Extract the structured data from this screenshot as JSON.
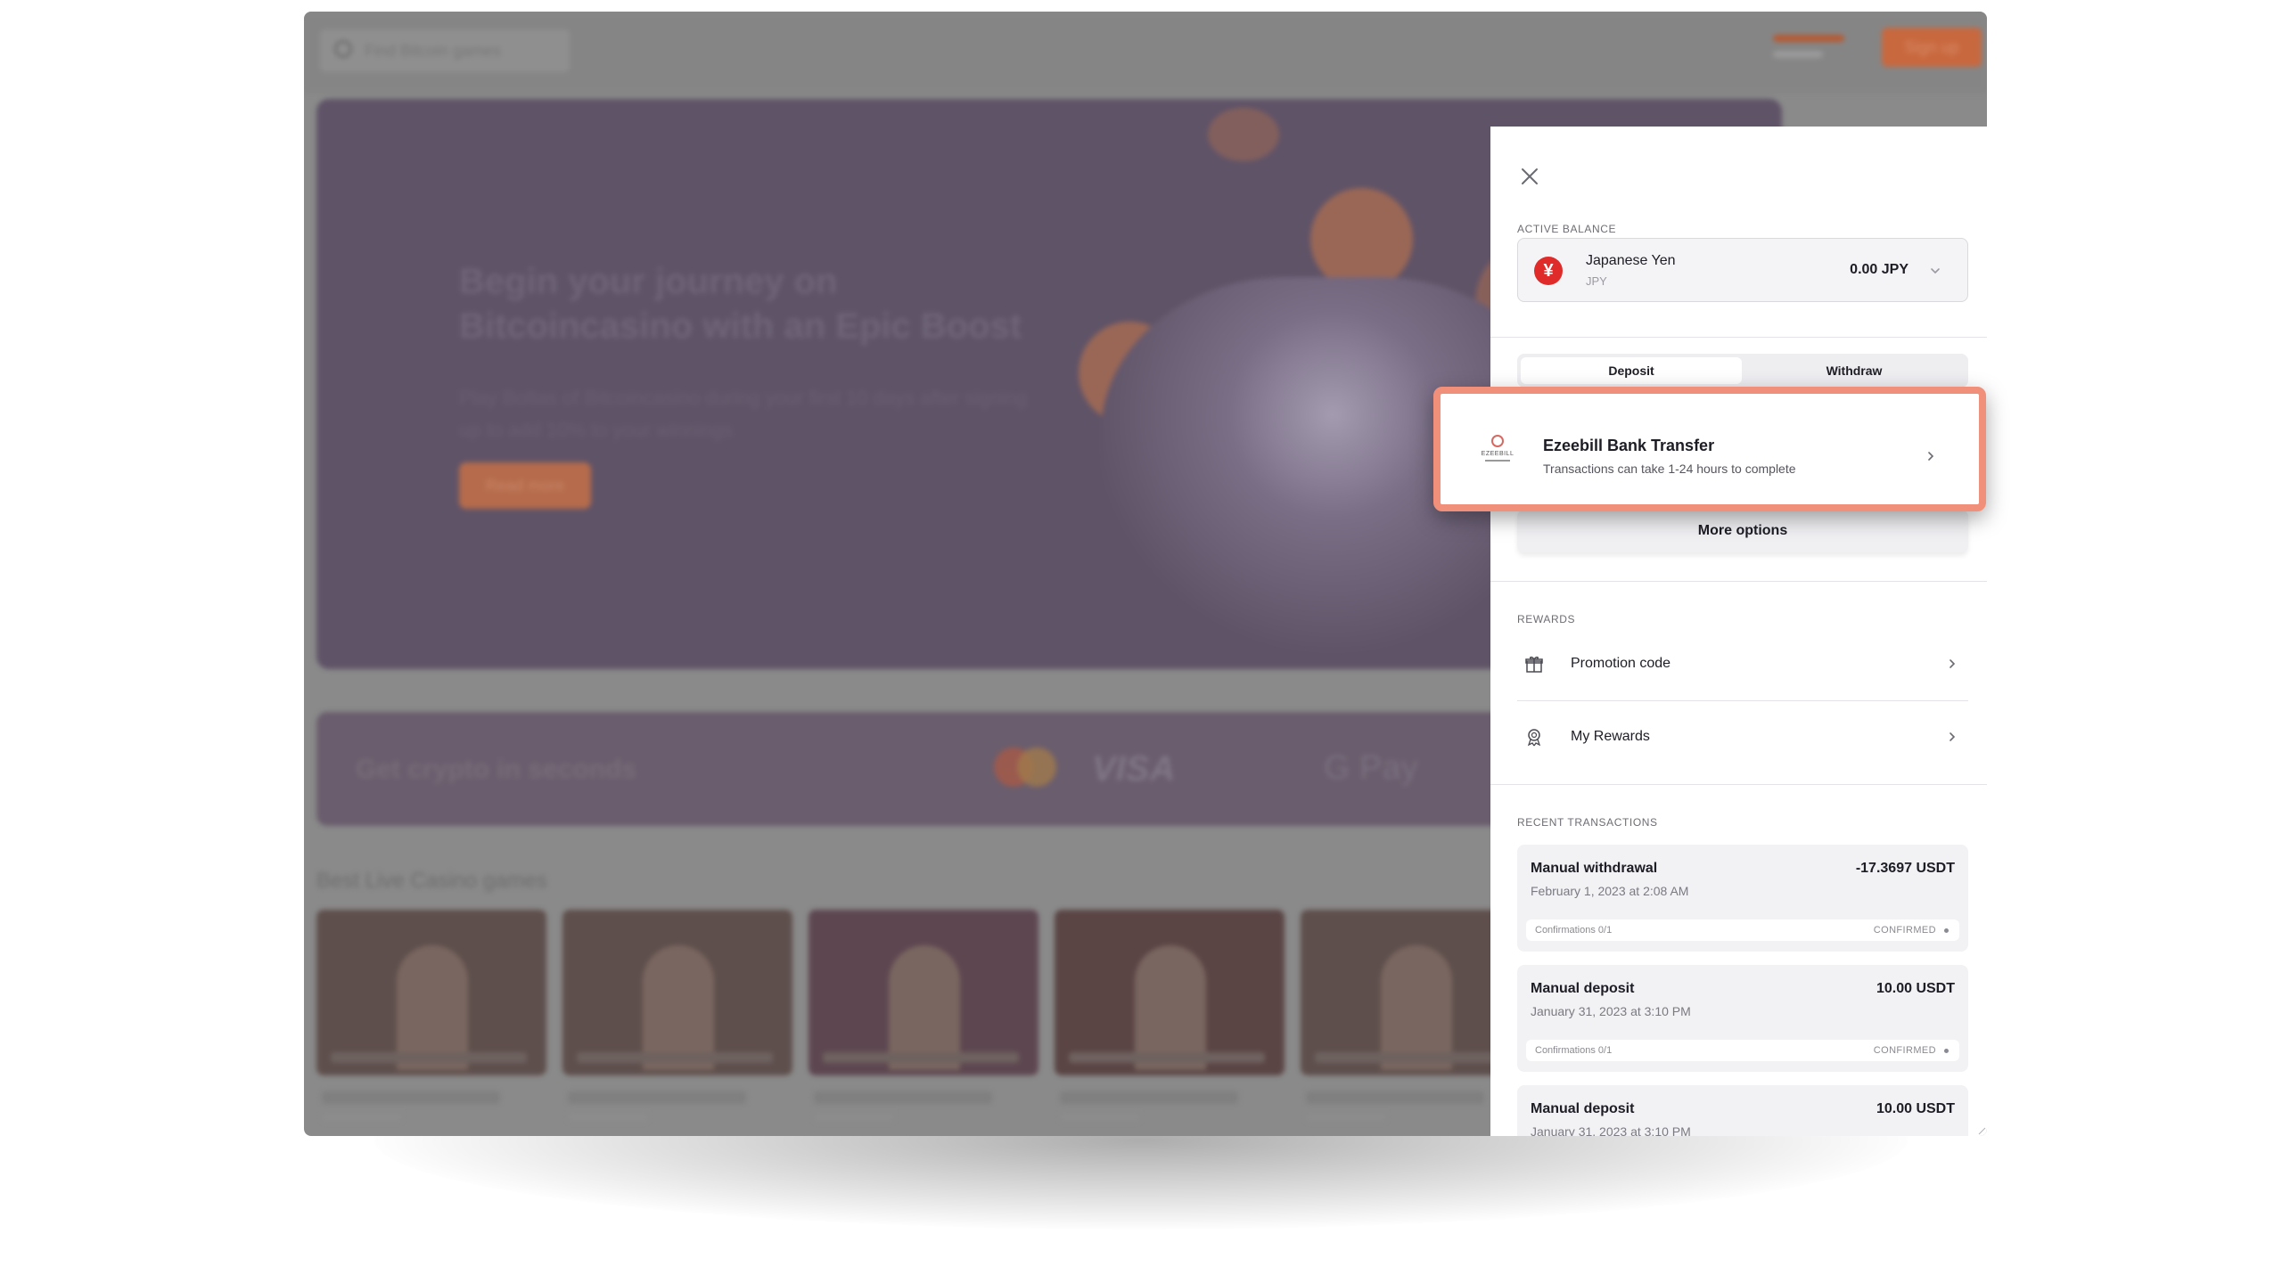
{
  "background": {
    "search_placeholder": "Find Bitcoin games",
    "signup_label": "Sign up",
    "hero_title": "Begin your journey on Bitcoincasino with an Epic Boost",
    "hero_desc": "Play Boltas of Bitcoincasino during your first 10 days after signing up to add 10% to your winnings",
    "hero_button": "Read more",
    "banner_text": "Get crypto in seconds",
    "banner_visa": "VISA",
    "banner_pay": "G Pay",
    "games_section_title": "Best Live Casino games"
  },
  "drawer": {
    "close_label": "Close",
    "active_balance_label": "Active balance",
    "currency": {
      "name": "Japanese Yen",
      "code": "JPY",
      "symbol": "¥",
      "amount": "0.00 JPY",
      "icon": "yen-coin-icon",
      "color": "#e02b2b"
    },
    "tabs": [
      {
        "label": "Deposit",
        "active": true
      },
      {
        "label": "Withdraw",
        "active": false
      }
    ],
    "payment_option": {
      "name": "Ezeebill Bank Transfer",
      "description": "Transactions can take 1-24 hours to complete",
      "logo_text": "EZEEBILL",
      "icon": "ezeebill-logo",
      "highlight_color": "#f1907a"
    },
    "more_options_label": "More options",
    "rewards_label": "Rewards",
    "rewards": [
      {
        "label": "Promotion code",
        "icon": "gift-icon"
      },
      {
        "label": "My Rewards",
        "icon": "medal-icon"
      }
    ],
    "recent_transactions_label": "Recent transactions",
    "transactions": [
      {
        "type": "Manual withdrawal",
        "amount": "-17.3697 USDT",
        "date": "February 1, 2023 at 2:08 AM",
        "confirmations": "Confirmations 0/1",
        "status": "CONFIRMED"
      },
      {
        "type": "Manual deposit",
        "amount": "10.00 USDT",
        "date": "January 31, 2023 at 3:10 PM",
        "confirmations": "Confirmations 0/1",
        "status": "CONFIRMED"
      },
      {
        "type": "Manual deposit",
        "amount": "10.00 USDT",
        "date": "January 31, 2023 at 3:10 PM",
        "confirmations": "",
        "status": ""
      }
    ]
  }
}
